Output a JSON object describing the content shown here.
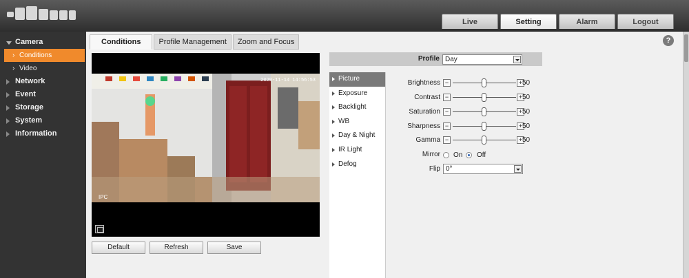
{
  "header": {
    "nav": [
      "Live",
      "Setting",
      "Alarm",
      "Logout"
    ],
    "active_nav": "Setting"
  },
  "sidebar": {
    "camera": "Camera",
    "conditions": "Conditions",
    "video": "Video",
    "network": "Network",
    "event": "Event",
    "storage": "Storage",
    "system": "System",
    "information": "Information"
  },
  "tabs": [
    "Conditions",
    "Profile Management",
    "Zoom and Focus"
  ],
  "help": "?",
  "video": {
    "osd_time": "2020-11-14 14:56:53",
    "osd_channel": "IPC"
  },
  "buttons": {
    "default": "Default",
    "refresh": "Refresh",
    "save": "Save"
  },
  "profile": {
    "label": "Profile",
    "value": "Day"
  },
  "menu": [
    "Picture",
    "Exposure",
    "Backlight",
    "WB",
    "Day & Night",
    "IR Light",
    "Defog"
  ],
  "menu_active": "Picture",
  "picture": {
    "brightness": {
      "label": "Brightness",
      "value": 50
    },
    "contrast": {
      "label": "Contrast",
      "value": 50
    },
    "saturation": {
      "label": "Saturation",
      "value": 50
    },
    "sharpness": {
      "label": "Sharpness",
      "value": 50
    },
    "gamma": {
      "label": "Gamma",
      "value": 50
    },
    "mirror": {
      "label": "Mirror",
      "on": "On",
      "off": "Off",
      "selected": "Off"
    },
    "flip": {
      "label": "Flip",
      "value": "0°"
    }
  },
  "colors": {
    "accent": "#f08a2c",
    "header": "#2e2e2e",
    "sidebar": "#333333"
  }
}
